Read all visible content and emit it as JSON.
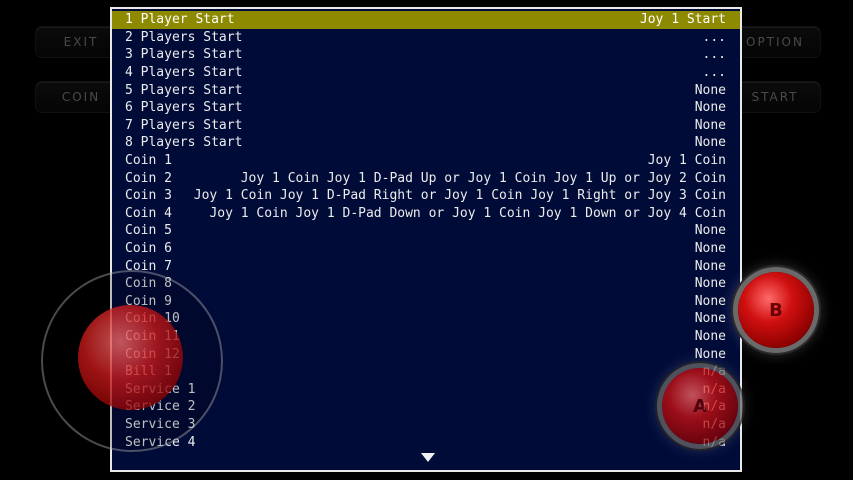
{
  "side_buttons": {
    "exit": "EXIT",
    "coin": "COIN",
    "option": "OPTION",
    "start": "START"
  },
  "action_buttons": {
    "b": "B",
    "a": "A"
  },
  "menu": {
    "rows": [
      {
        "label": "1 Player Start",
        "value": "Joy 1 Start"
      },
      {
        "label": "2 Players Start",
        "value": "..."
      },
      {
        "label": "3 Players Start",
        "value": "..."
      },
      {
        "label": "4 Players Start",
        "value": "..."
      },
      {
        "label": "5 Players Start",
        "value": "None"
      },
      {
        "label": "6 Players Start",
        "value": "None"
      },
      {
        "label": "7 Players Start",
        "value": "None"
      },
      {
        "label": "8 Players Start",
        "value": "None"
      },
      {
        "label": "Coin 1",
        "value": "Joy 1 Coin"
      },
      {
        "label": "Coin 2",
        "value": "Joy 1 Coin Joy 1 D-Pad Up or Joy 1 Coin Joy 1 Up or Joy 2 Coin"
      },
      {
        "label": "Coin 3",
        "value": "Joy 1 Coin Joy 1 D-Pad Right or Joy 1 Coin Joy 1 Right or Joy 3 Coin"
      },
      {
        "label": "Coin 4",
        "value": "Joy 1 Coin Joy 1 D-Pad Down or Joy 1 Coin Joy 1 Down or Joy 4 Coin"
      },
      {
        "label": "Coin 5",
        "value": "None"
      },
      {
        "label": "Coin 6",
        "value": "None"
      },
      {
        "label": "Coin 7",
        "value": "None"
      },
      {
        "label": "Coin 8",
        "value": "None"
      },
      {
        "label": "Coin 9",
        "value": "None"
      },
      {
        "label": "Coin 10",
        "value": "None"
      },
      {
        "label": "Coin 11",
        "value": "None"
      },
      {
        "label": "Coin 12",
        "value": "None"
      },
      {
        "label": "Bill 1",
        "value": "n/a"
      },
      {
        "label": "Service 1",
        "value": "n/a"
      },
      {
        "label": "Service 2",
        "value": "n/a"
      },
      {
        "label": "Service 3",
        "value": "n/a"
      },
      {
        "label": "Service 4",
        "value": "n/a"
      }
    ],
    "selected_index": 0
  },
  "colors": {
    "menu_bg": "#000b38",
    "selected_bg": "#8e8a00",
    "text": "#ececec",
    "accent_red": "#d01010"
  }
}
